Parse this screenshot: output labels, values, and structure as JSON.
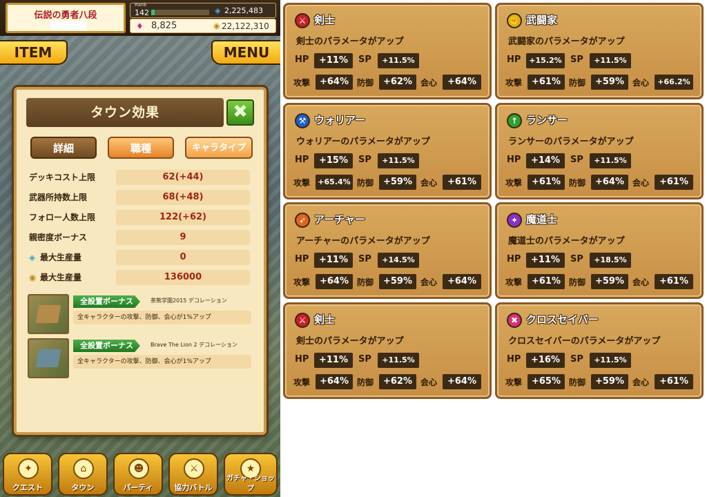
{
  "header": {
    "player_title": "伝説の勇者八段",
    "rank_label": "Rank",
    "rank": "142",
    "rank_progress": 0.06,
    "stamina": "2,225,483",
    "rubies": "8,825",
    "coins": "22,122,310"
  },
  "buttons": {
    "item": "ITEM",
    "menu": "MENU"
  },
  "dialog": {
    "title": "タウン効果",
    "close": "✖",
    "tabs": [
      "詳細",
      "職種",
      "キャラタイプ"
    ],
    "stats": [
      {
        "label": "デッキコスト上限",
        "value": "62(+44)",
        "icon": ""
      },
      {
        "label": "武器所持数上限",
        "value": "68(+48)",
        "icon": ""
      },
      {
        "label": "フォロー人数上限",
        "value": "122(+62)",
        "icon": ""
      },
      {
        "label": "親密度ボーナス",
        "value": "9",
        "icon": ""
      },
      {
        "label": "最大生産量",
        "value": "0",
        "icon": "stamina-icon"
      },
      {
        "label": "最大生産量",
        "value": "136000",
        "icon": "coin-icon"
      }
    ],
    "bonuses": [
      {
        "tag": "全設置ボーナス",
        "deco": "茶熊学園2015 デコレーション",
        "desc": "全キャラクターの攻撃、防御、会心が1%アップ"
      },
      {
        "tag": "全設置ボーナス",
        "deco": "Brave The Lion 2 デコレーション",
        "desc": "全キャラクターの攻撃、防御、会心が1%アップ"
      }
    ]
  },
  "nav": [
    "クエスト",
    "タウン",
    "パーティ",
    "協力バトル",
    "ガチャ・ショップ"
  ],
  "stat_labels": {
    "hp": "HP",
    "sp": "SP",
    "atk": "攻撃",
    "def": "防御",
    "crit": "会心"
  },
  "jobs": [
    {
      "name": "剣士",
      "desc": "剣士のパラメータがアップ",
      "hp": "+11%",
      "sp": "+11.5%",
      "atk": "+64%",
      "def": "+62%",
      "crit": "+64%",
      "color": "#c8202a",
      "icon": "sword-icon"
    },
    {
      "name": "武闘家",
      "desc": "武闘家のパラメータがアップ",
      "hp": "+15.2%",
      "sp": "+11.5%",
      "atk": "+61%",
      "def": "+59%",
      "crit": "+66.2%",
      "color": "#d6b90c",
      "icon": "fist-icon"
    },
    {
      "name": "ウォリアー",
      "desc": "ウォリアーのパラメータがアップ",
      "hp": "+15%",
      "sp": "+11.5%",
      "atk": "+65.4%",
      "def": "+59%",
      "crit": "+61%",
      "color": "#1f5fc8",
      "icon": "axe-icon"
    },
    {
      "name": "ランサー",
      "desc": "ランサーのパラメータがアップ",
      "hp": "+14%",
      "sp": "+11.5%",
      "atk": "+61%",
      "def": "+64%",
      "crit": "+61%",
      "color": "#2fa02a",
      "icon": "lance-icon"
    },
    {
      "name": "アーチャー",
      "desc": "アーチャーのパラメータがアップ",
      "hp": "+11%",
      "sp": "+14.5%",
      "atk": "+64%",
      "def": "+59%",
      "crit": "+64%",
      "color": "#e0641a",
      "icon": "bow-icon"
    },
    {
      "name": "魔道士",
      "desc": "魔道士のパラメータがアップ",
      "hp": "+11%",
      "sp": "+18.5%",
      "atk": "+61%",
      "def": "+59%",
      "crit": "+61%",
      "color": "#8a2fc8",
      "icon": "staff-icon"
    },
    {
      "name": "剣士",
      "desc": "剣士のパラメータがアップ",
      "hp": "+11%",
      "sp": "+11.5%",
      "atk": "+64%",
      "def": "+62%",
      "crit": "+64%",
      "color": "#c8202a",
      "icon": "sword-icon"
    },
    {
      "name": "クロスセイバー",
      "desc": "クロスセイバーのパラメータがアップ",
      "hp": "+16%",
      "sp": "+11.5%",
      "atk": "+65%",
      "def": "+59%",
      "crit": "+61%",
      "color": "#d8307a",
      "icon": "cross-saber-icon"
    }
  ]
}
